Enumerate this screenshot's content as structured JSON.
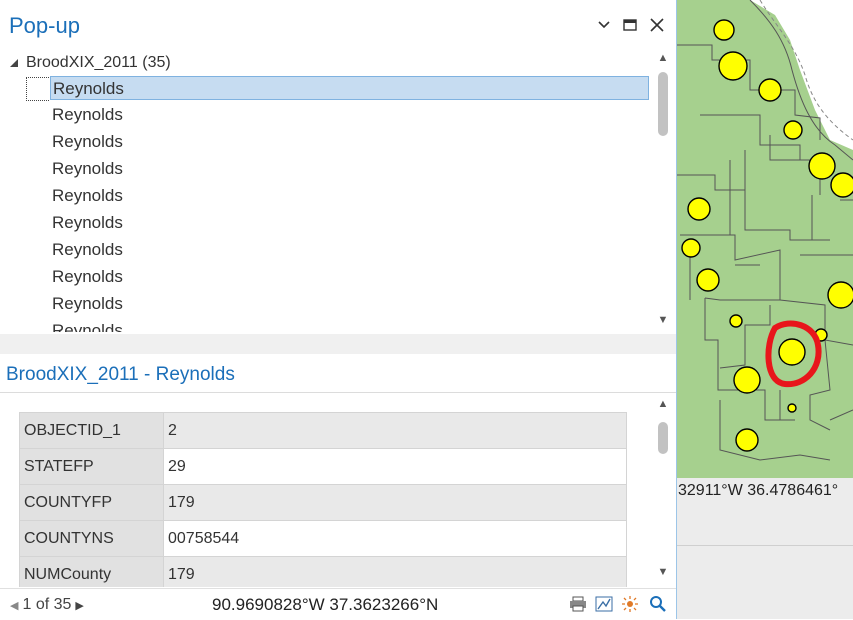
{
  "popup": {
    "title": "Pop-up",
    "layer": {
      "name_count": "BroodXIX_2011 (35)"
    },
    "items": [
      "Reynolds",
      "Reynolds",
      "Reynolds",
      "Reynolds",
      "Reynolds",
      "Reynolds",
      "Reynolds",
      "Reynolds",
      "Reynolds",
      "Reynolds"
    ],
    "detail_title": "BroodXIX_2011 - Reynolds",
    "attributes": [
      {
        "field": "OBJECTID_1",
        "value": "2"
      },
      {
        "field": "STATEFP",
        "value": "29"
      },
      {
        "field": "COUNTYFP",
        "value": "179"
      },
      {
        "field": "COUNTYNS",
        "value": "00758544"
      },
      {
        "field": "NUMCounty",
        "value": "179"
      }
    ],
    "pager": {
      "text": "1 of 35"
    },
    "coordinates": "90.9690828°W 37.3623266°N"
  },
  "map": {
    "coordinates": "32911°W 36.4786461°",
    "colors": {
      "county_fill": "#a6d08e",
      "symbol_fill": "#ffff00",
      "highlight": "#e8161b"
    }
  },
  "icons": [
    "minimize-icon",
    "maximize-icon",
    "close-icon",
    "collapse-caret-icon",
    "print-icon",
    "zoom-to-icon",
    "flash-icon",
    "pan-to-icon"
  ]
}
